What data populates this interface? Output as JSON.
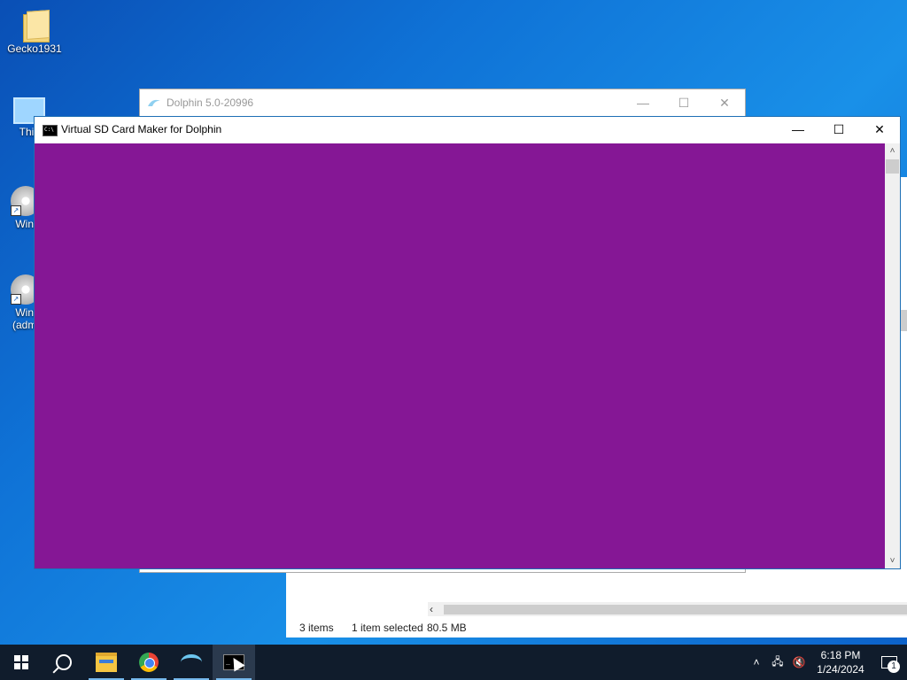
{
  "desktop": {
    "icons": [
      {
        "label": "Gecko1931",
        "icon": "folder-icon"
      },
      {
        "label": "This",
        "icon": "this-pc-icon"
      },
      {
        "label": "Winl",
        "icon": "disc-icon"
      },
      {
        "label": "Winl",
        "label2": "(admi",
        "icon": "disc-icon"
      }
    ]
  },
  "explorer": {
    "status_items": "3 items",
    "status_selected": "1 item selected",
    "status_size": "80.5 MB",
    "scroll_left": "‹"
  },
  "dolphin_window": {
    "title": "Dolphin 5.0-20996",
    "minimize": "—",
    "maximize": "☐",
    "close": "✕"
  },
  "console_window": {
    "title": "Virtual SD Card Maker for Dolphin",
    "minimize": "—",
    "maximize": "☐",
    "close": "✕",
    "background_color": "#851795",
    "scroll_up": "˄",
    "scroll_down": "˅"
  },
  "taskbar": {
    "apps": [
      "start",
      "search",
      "file-explorer",
      "chrome",
      "dolphin",
      "console"
    ],
    "tray": {
      "chevron": "˄",
      "network": "🖧",
      "volume": "🔇"
    },
    "time": "6:18 PM",
    "date": "1/24/2024",
    "notification_count": "1"
  }
}
